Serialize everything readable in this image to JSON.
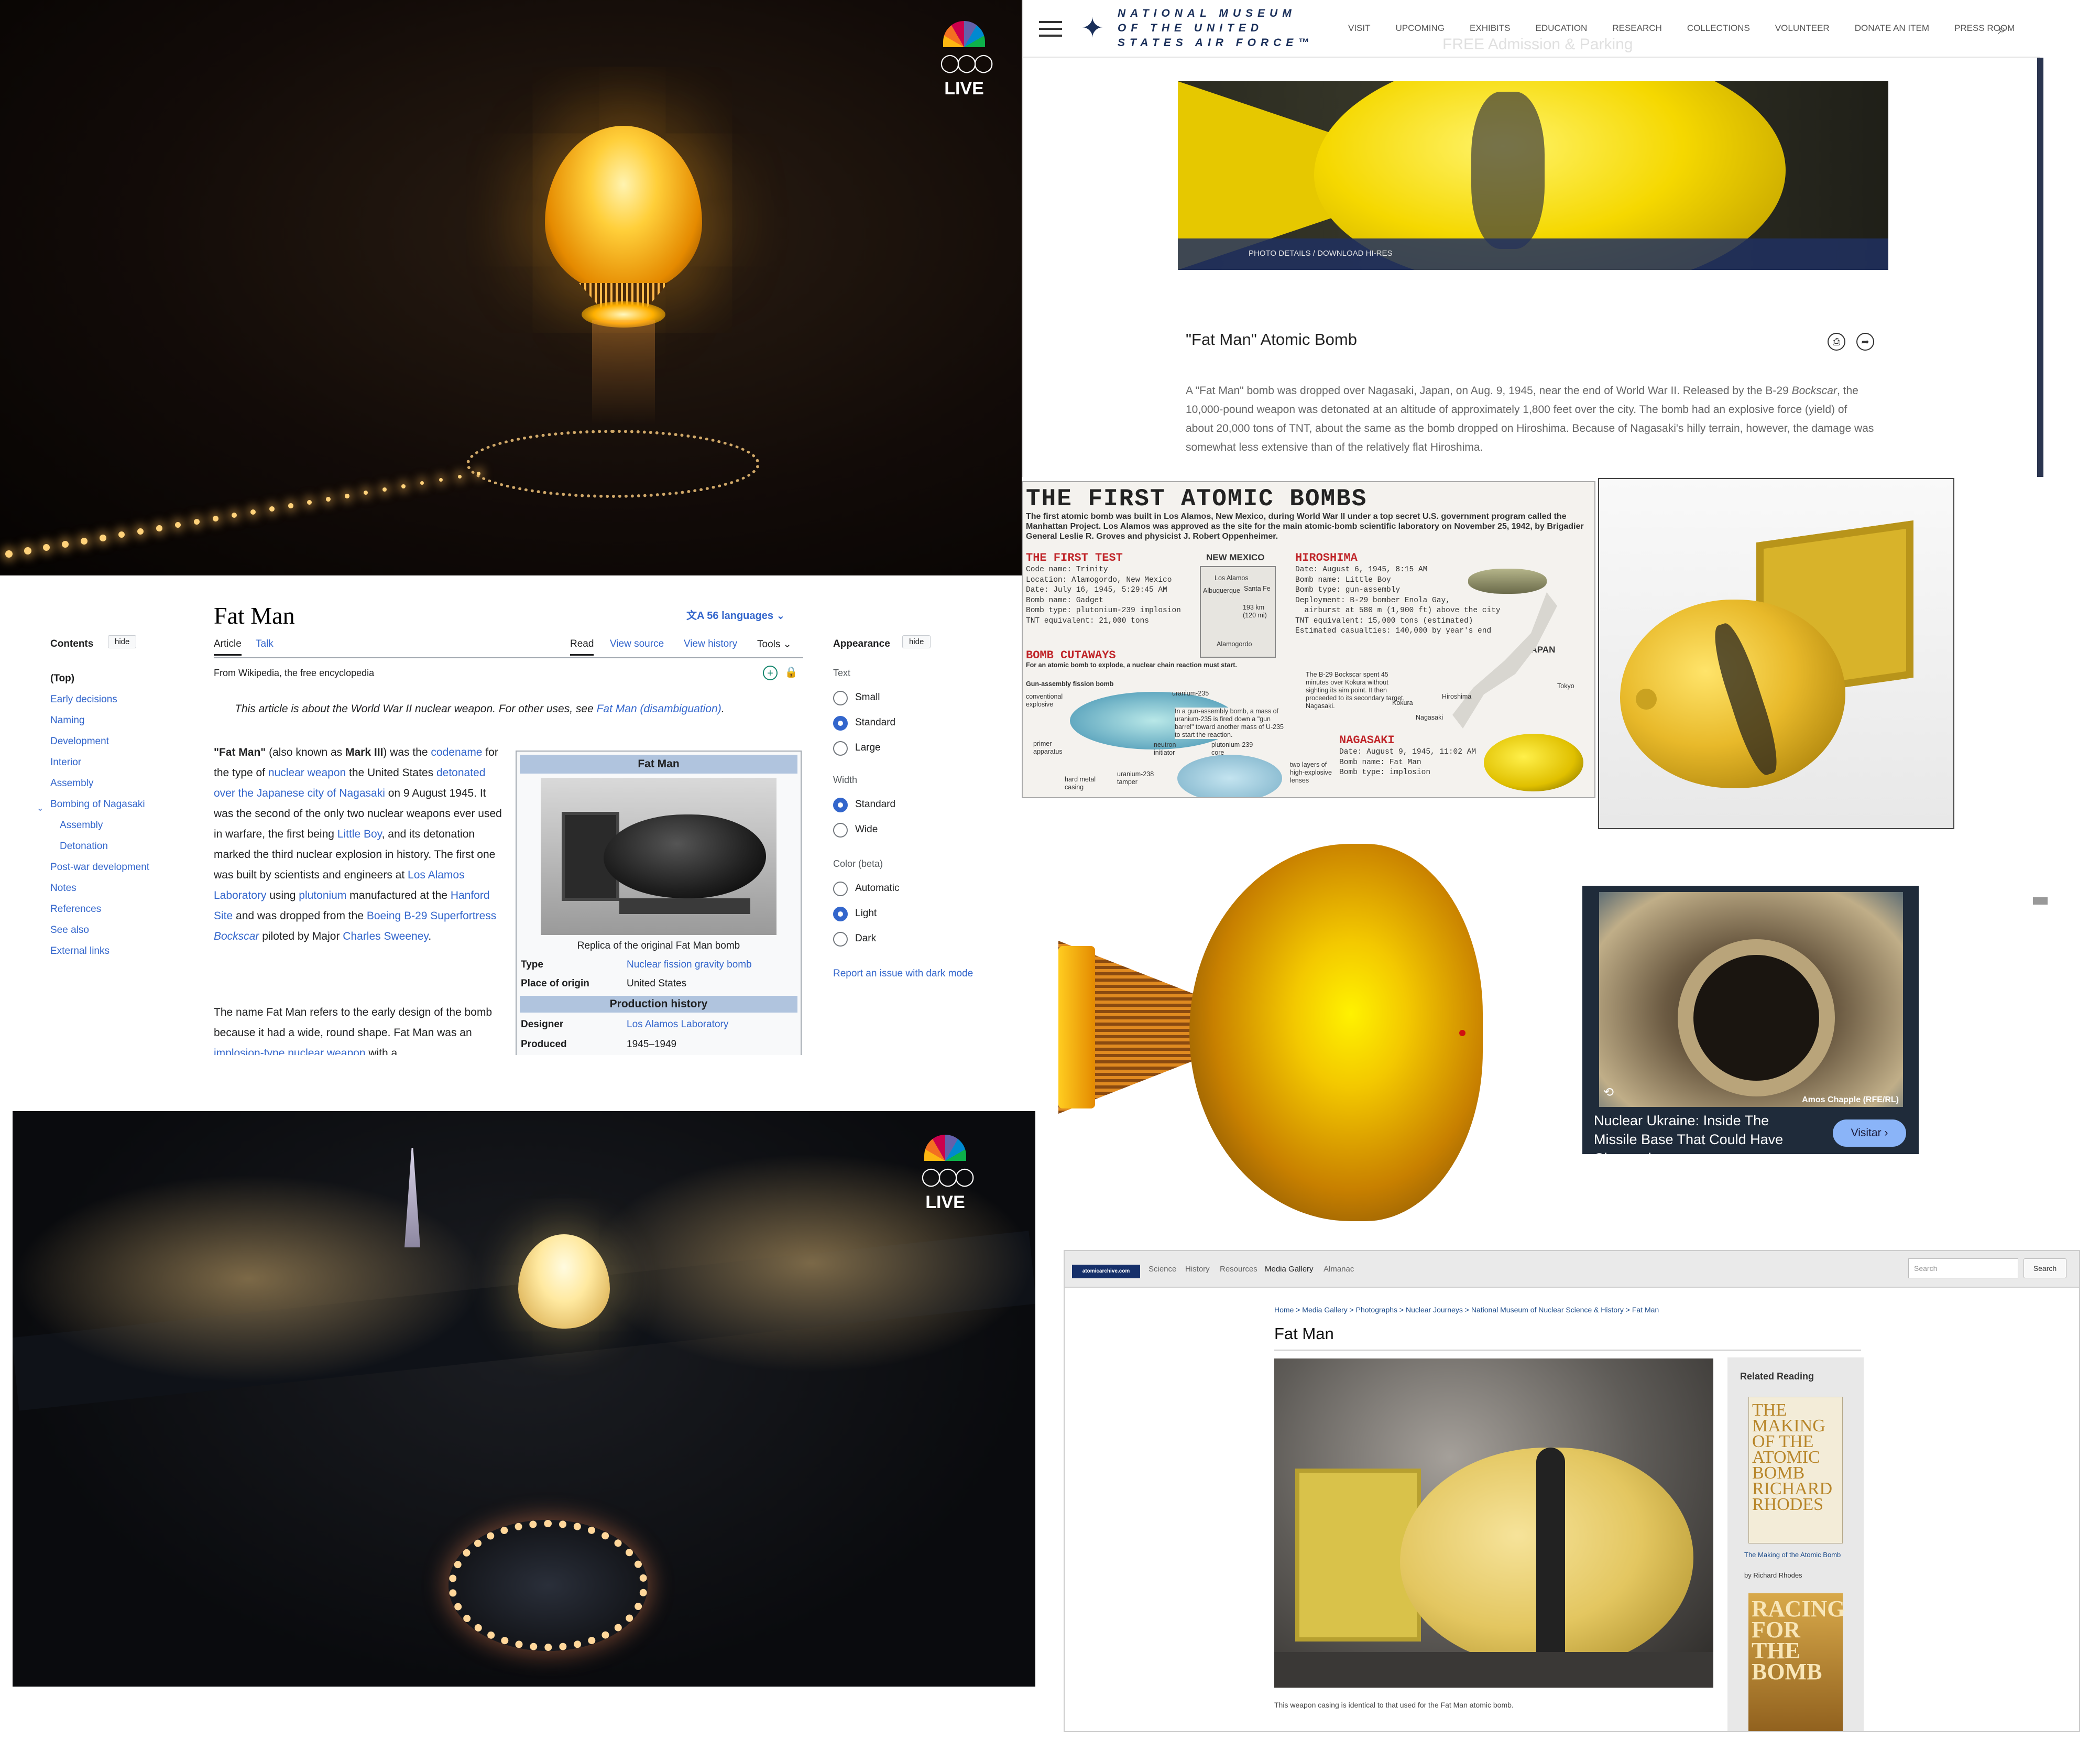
{
  "live_badge": {
    "text": "LIVE",
    "rings_icon": "olympic-rings-icon",
    "logo_icon": "nbc-peacock-icon"
  },
  "museum": {
    "name_lines": [
      "NATIONAL MUSEUM",
      "OF THE UNITED",
      "STATES AIR FORCE™"
    ],
    "nav": [
      "VISIT",
      "UPCOMING",
      "EXHIBITS",
      "EDUCATION",
      "RESEARCH",
      "COLLECTIONS",
      "VOLUNTEER",
      "DONATE AN ITEM",
      "PRESS ROOM"
    ],
    "ghost_banner": "FREE Admission & Parking",
    "photo_caption": "PHOTO DETAILS  /  DOWNLOAD HI-RES",
    "title": "\"Fat Man\" Atomic Bomb",
    "body_1": "A \"Fat Man\" bomb was dropped over Nagasaki, Japan, on Aug. 9, 1945, near the end of World War II. Released by the B-29 ",
    "body_italic": "Bockscar",
    "body_2": ", the 10,000-pound weapon was detonated at an altitude of approximately 1,800 feet over the city. The bomb had an explosive force (yield) of about 20,000 tons of TNT, about the same as the bomb dropped on Hiroshima. Because of Nagasaki's hilly terrain, however, the damage was somewhat less extensive than of the relatively flat Hiroshima."
  },
  "wiki": {
    "contents_label": "Contents",
    "hide_label": "hide",
    "toc": [
      "(Top)",
      "Early decisions",
      "Naming",
      "Development",
      "Interior",
      "Assembly",
      "Bombing of Nagasaki",
      "Assembly",
      "Detonation",
      "Post-war development",
      "Notes",
      "References",
      "See also",
      "External links"
    ],
    "title": "Fat Man",
    "languages": "56 languages",
    "tabs_left": [
      "Article",
      "Talk"
    ],
    "tabs_right": [
      "Read",
      "View source",
      "View history",
      "Tools"
    ],
    "from": "From Wikipedia, the free encyclopedia",
    "hatnote": "This article is about the World War II nuclear weapon. For other uses, see ",
    "hatnote_link": "Fat Man (disambiguation)",
    "para1_html": "<b>\"Fat Man\"</b> (also known as <b>Mark III</b>) was the <a>codename</a> for the type of <a>nuclear weapon</a> the United States <a>detonated over the Japanese city of Nagasaki</a> on 9 August 1945. It was the second of the only two nuclear weapons ever used in warfare, the first being <a>Little Boy</a>, and its detonation marked the third nuclear explosion in history. The first one was built by scientists and engineers at <a>Los Alamos Laboratory</a> using <a>plutonium</a> manufactured at the <a>Hanford Site</a> and was dropped from the <a>Boeing B-29 Superfortress</a> <a><i>Bockscar</i></a> piloted by Major <a>Charles Sweeney</a>.",
    "para2_html": "The name Fat Man refers to the early design of the bomb because it had a wide, round shape. Fat Man was an <a>implosion-type nuclear weapon</a> with a",
    "infobox": {
      "title": "Fat Man",
      "caption": "Replica of the original Fat Man bomb",
      "type_k": "Type",
      "type_v": "Nuclear fission gravity bomb",
      "origin_k": "Place of origin",
      "origin_v": "United States",
      "section": "Production history",
      "designer_k": "Designer",
      "designer_v": "Los Alamos Laboratory",
      "produced_k": "Produced",
      "produced_v": "1945–1949"
    },
    "appearance": {
      "label": "Appearance",
      "text_label": "Text",
      "text_opts": [
        "Small",
        "Standard",
        "Large"
      ],
      "text_selected": 1,
      "width_label": "Width",
      "width_opts": [
        "Standard",
        "Wide"
      ],
      "width_selected": 0,
      "color_label": "Color (beta)",
      "color_opts": [
        "Automatic",
        "Light",
        "Dark"
      ],
      "color_selected": 1,
      "report": "Report an issue with dark mode"
    }
  },
  "infographic": {
    "title": "THE FIRST ATOMIC BOMBS",
    "intro": "The first atomic bomb was built in Los Alamos, New Mexico, during World War II under a top secret U.S. government program called the Manhattan Project. Los Alamos was approved as the site for the main atomic-bomb scientific laboratory on November 25, 1942, by Brigadier General Leslie R. Groves and physicist J. Robert Oppenheimer.",
    "first_test_h": "THE FIRST TEST",
    "first_test": "Code name: Trinity\nLocation: Alamogordo, New Mexico\nDate: July 16, 1945, 5:29:45 AM\nBomb name: Gadget\nBomb type: plutonium-239 implosion\nTNT equivalent: 21,000 tons",
    "new_mexico": "NEW MEXICO",
    "nm_places": [
      "Los Alamos",
      "Santa Fe",
      "Albuquerque",
      "Alamogordo"
    ],
    "nm_dist": "193 km (120 mi)",
    "hiroshima_h": "HIROSHIMA",
    "hiroshima": "Date: August 6, 1945, 8:15 AM\nBomb name: Little Boy\nBomb type: gun-assembly\nDeployment: B-29 bomber Enola Gay,\n  airburst at 580 m (1,900 ft) above the city\nTNT equivalent: 15,000 tons (estimated)\nEstimated casualties: 140,000 by year's end",
    "cutaways_h": "BOMB CUTAWAYS",
    "cutaways_sub": "For an atomic bomb to explode, a nuclear chain reaction must start.",
    "gun_label": "Gun-assembly fission bomb",
    "gun_desc": "In a gun-assembly bomb, a mass of uranium-235 is fired down a \"gun barrel\" toward another mass of U-235 to start the reaction.",
    "cut_labels": [
      "conventional explosive",
      "uranium-235",
      "primer apparatus",
      "neutron initiator",
      "plutonium-239 core",
      "hard metal casing",
      "uranium-238 tamper",
      "two layers of high-explosive lenses"
    ],
    "japan": "JAPAN",
    "japan_places": [
      "Hiroshima",
      "Tokyo",
      "Kokura",
      "Nagasaki"
    ],
    "b29_note": "The B-29 Bockscar spent 45 minutes over Kokura without sighting its aim point. It then proceeded to its secondary target, Nagasaki.",
    "nagasaki_h": "NAGASAKI",
    "nagasaki": "Date: August 9, 1945, 11:02 AM\nBomb name: Fat Man\nBomb type: implosion"
  },
  "video": {
    "credit": "Amos Chapple (RFE/RL)",
    "title": "Nuclear Ukraine: Inside The Missile Base That Could Have Changed...",
    "button": "Visitar"
  },
  "archive": {
    "nav": [
      "Science",
      "History",
      "Resources",
      "Media Gallery",
      "Almanac"
    ],
    "search_placeholder": "Search",
    "search_button": "Search",
    "breadcrumb": "Home  >  Media Gallery  >  Photographs  >  Nuclear Journeys  >  National Museum of Nuclear Science & History  >  Fat Man",
    "title": "Fat Man",
    "caption": "This weapon casing is identical to that used for the Fat Man atomic bomb.",
    "related": "Related Reading",
    "book1_cover": "THE MAKING OF THE ATOMIC BOMB RICHARD RHODES",
    "book1_title": "The Making of the Atomic Bomb",
    "book1_by": "by Richard Rhodes",
    "book2_cover": "RACING FOR THE BOMB"
  }
}
